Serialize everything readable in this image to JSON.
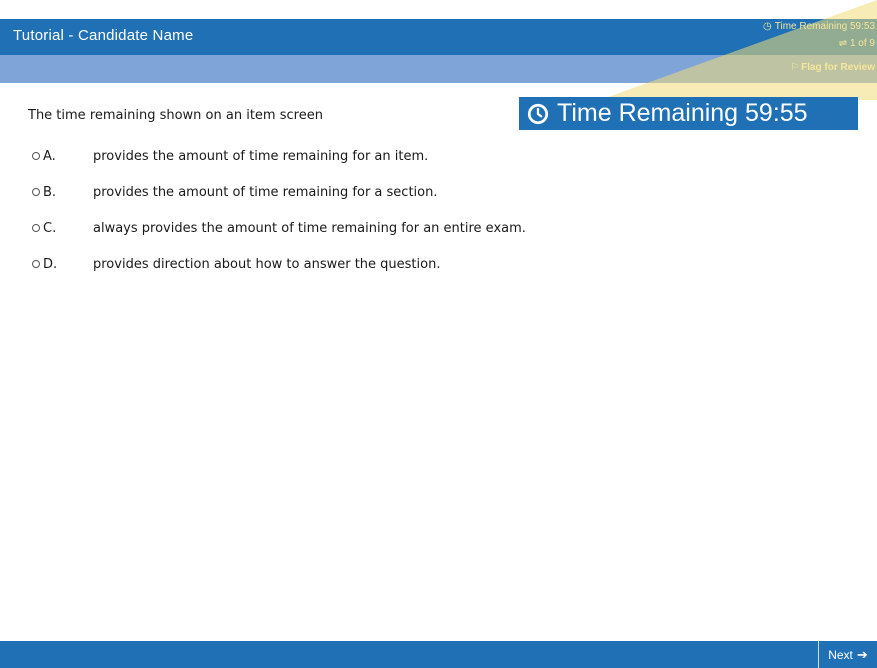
{
  "header": {
    "title": "Tutorial - Candidate Name",
    "time_remaining_small": "Time Remaining 59:53",
    "page_indicator": "1 of 9",
    "flag_label": "Flag for Review"
  },
  "timer_callout": {
    "text": "Time Remaining 59:55"
  },
  "question": {
    "stem": "The time remaining shown on an item screen",
    "options": [
      {
        "letter": "A.",
        "text": "provides the amount of time remaining for an item."
      },
      {
        "letter": "B.",
        "text": "provides the amount of time remaining for a section."
      },
      {
        "letter": "C.",
        "text": "always provides the amount of time remaining for an entire exam."
      },
      {
        "letter": "D.",
        "text": "provides direction about how to answer the question."
      }
    ]
  },
  "footer": {
    "next_label": "Next"
  },
  "colors": {
    "bar_blue": "#1f70b4",
    "sub_bar_blue": "#7ea4d8",
    "highlight_yellow": "#f6e79a"
  },
  "icons": {
    "timer": "clock-icon",
    "page": "page-icon",
    "flag": "flag-icon",
    "next": "arrow-right-icon"
  }
}
